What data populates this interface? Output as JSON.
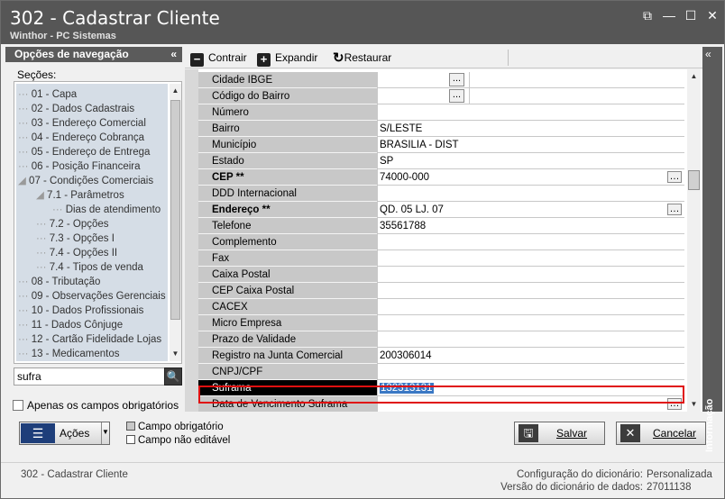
{
  "window": {
    "title": "302 - Cadastrar Cliente",
    "subtitle": "Winthor - PC Sistemas",
    "buttons": {
      "restore": "⧉",
      "minimize": "—",
      "maximize": "☐",
      "close": "✕"
    }
  },
  "nav": {
    "header": "Opções de navegação",
    "collapse_icon": "«",
    "sections_label": "Seções:",
    "items": [
      {
        "label": "01 - Capa",
        "indent": 0
      },
      {
        "label": "02 - Dados Cadastrais",
        "indent": 0
      },
      {
        "label": "03 - Endereço Comercial",
        "indent": 0
      },
      {
        "label": "04 - Endereço Cobrança",
        "indent": 0
      },
      {
        "label": "05 - Endereço de Entrega",
        "indent": 0
      },
      {
        "label": "06 - Posição Financeira",
        "indent": 0
      },
      {
        "label": "07 - Condições Comerciais",
        "indent": 0,
        "expander": "◢"
      },
      {
        "label": "7.1 - Parâmetros",
        "indent": 1,
        "expander": "◢"
      },
      {
        "label": "Dias de atendimento",
        "indent": 2
      },
      {
        "label": "7.2 - Opções",
        "indent": 1
      },
      {
        "label": "7.3 - Opções I",
        "indent": 1
      },
      {
        "label": "7.4 - Opções II",
        "indent": 1
      },
      {
        "label": "7.4 - Tipos de venda",
        "indent": 1
      },
      {
        "label": "08 - Tributação",
        "indent": 0
      },
      {
        "label": "09 - Observações Gerenciais",
        "indent": 0
      },
      {
        "label": "10 - Dados Profissionais",
        "indent": 0
      },
      {
        "label": "11 - Dados Cônjuge",
        "indent": 0
      },
      {
        "label": "12 - Cartão Fidelidade Lojas",
        "indent": 0
      },
      {
        "label": "13 - Medicamentos",
        "indent": 0
      }
    ],
    "search_value": "sufra",
    "search_icon": "🔍",
    "required_only_label": "Apenas os campos obrigatórios"
  },
  "toolbar": {
    "collapse_label": "Contrair",
    "expand_label": "Expandir",
    "restore_label": "Restaurar"
  },
  "fields": [
    {
      "label": "Cidade IBGE",
      "value": "",
      "button": true
    },
    {
      "label": "Código do Bairro",
      "value": "",
      "button": true
    },
    {
      "label": "Número",
      "value": ""
    },
    {
      "label": "Bairro",
      "value": "S/LESTE"
    },
    {
      "label": "Município",
      "value": "BRASILIA - DIST"
    },
    {
      "label": "Estado",
      "value": "SP"
    },
    {
      "label": "CEP **",
      "value": "74000-000",
      "bold": true,
      "ellipsis": true
    },
    {
      "label": "DDD Internacional",
      "value": ""
    },
    {
      "label": "Endereço **",
      "value": "QD. 05 LJ. 07",
      "bold": true,
      "ellipsis": true
    },
    {
      "label": "Telefone",
      "value": "35561788"
    },
    {
      "label": "Complemento",
      "value": ""
    },
    {
      "label": "Fax",
      "value": ""
    },
    {
      "label": "Caixa Postal",
      "value": ""
    },
    {
      "label": "CEP Caixa Postal",
      "value": ""
    },
    {
      "label": "CACEX",
      "value": ""
    },
    {
      "label": "Micro Empresa",
      "value": ""
    },
    {
      "label": "Prazo de Validade",
      "value": ""
    },
    {
      "label": "Registro na Junta Comercial",
      "value": "200306014"
    },
    {
      "label": "CNPJ/CPF",
      "value": ""
    },
    {
      "label": "Suframa",
      "value": "132313131",
      "selected": true
    },
    {
      "label": "Data de Vencimento Suframa",
      "value": "",
      "ellipsis": true
    }
  ],
  "info_panel": {
    "label": "Informação",
    "expand_icon": "«"
  },
  "actions": {
    "acoes_label": "Ações",
    "legend_required": "Campo obrigatório",
    "legend_readonly": "Campo não editável",
    "save_label": "Salvar",
    "cancel_label": "Cancelar"
  },
  "status": {
    "left": "302 - Cadastrar Cliente",
    "dict_config_label": "Configuração do dicionário:",
    "dict_config_value": "Personalizada",
    "dict_version_label": "Versão do dicionário de dados:",
    "dict_version_value": "27011138"
  }
}
